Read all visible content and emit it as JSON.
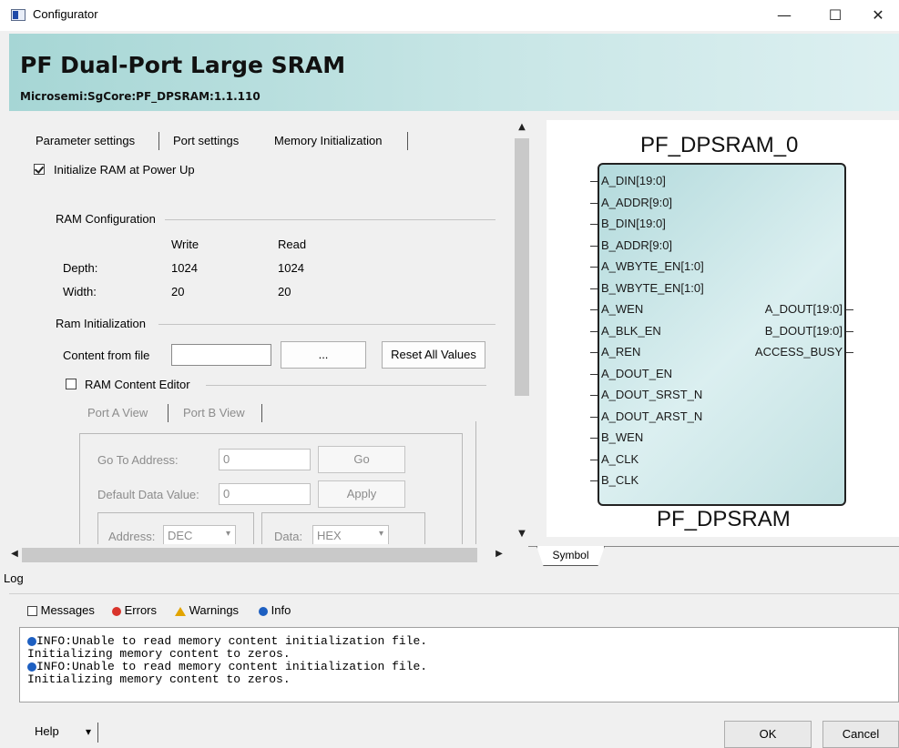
{
  "window": {
    "title": "Configurator",
    "minimize": "—",
    "maximize": "☐",
    "close": "✕"
  },
  "banner": {
    "title": "PF Dual-Port Large SRAM",
    "subtitle": "Microsemi:SgCore:PF_DPSRAM:1.1.110"
  },
  "tabs": [
    {
      "label": "Parameter settings"
    },
    {
      "label": "Port settings"
    },
    {
      "label": "Memory Initialization"
    }
  ],
  "init_ram": {
    "label": "Initialize RAM at Power Up",
    "checked": true
  },
  "ram_config": {
    "group_label": "RAM Configuration",
    "col_write": "Write",
    "col_read": "Read",
    "rows": [
      {
        "label": "Depth:",
        "write": "1024",
        "read": "1024"
      },
      {
        "label": "Width:",
        "write": "20",
        "read": "20"
      }
    ]
  },
  "ram_init": {
    "group_label": "Ram Initialization",
    "content_label": "Content from file",
    "content_value": "",
    "browse_label": "...",
    "reset_label": "Reset All Values"
  },
  "editor": {
    "label": "RAM Content Editor",
    "checked": false,
    "tab_a": "Port A View",
    "tab_b": "Port B View",
    "goto_label": "Go To Address:",
    "goto_value": "0",
    "go_button": "Go",
    "default_label": "Default Data Value:",
    "default_value": "0",
    "apply_button": "Apply",
    "address_label": "Address:",
    "address_value": "DEC",
    "data_label": "Data:",
    "data_value": "HEX"
  },
  "symbol": {
    "instance": "PF_DPSRAM_0",
    "component": "PF_DPSRAM",
    "left_pins": [
      "A_DIN[19:0]",
      "A_ADDR[9:0]",
      "B_DIN[19:0]",
      "B_ADDR[9:0]",
      "A_WBYTE_EN[1:0]",
      "B_WBYTE_EN[1:0]",
      "A_WEN",
      "A_BLK_EN",
      "A_REN",
      "A_DOUT_EN",
      "A_DOUT_SRST_N",
      "A_DOUT_ARST_N",
      "B_WEN",
      "A_CLK",
      "B_CLK"
    ],
    "right_pins": [
      "A_DOUT[19:0]",
      "B_DOUT[19:0]",
      "ACCESS_BUSY"
    ],
    "tab_label": "Symbol"
  },
  "log": {
    "title": "Log",
    "tabs": {
      "messages": "Messages",
      "errors": "Errors",
      "warnings": "Warnings",
      "info": "Info"
    },
    "lines": [
      "INFO:Unable to read memory content initialization file.",
      "Initializing memory content to zeros.",
      "INFO:Unable to read memory content initialization file.",
      "Initializing memory content to zeros."
    ]
  },
  "footer": {
    "help": "Help",
    "help_arrow": "▾",
    "ok": "OK",
    "cancel": "Cancel"
  },
  "icons": {
    "scroll_up": "▲",
    "scroll_down": "▼",
    "scroll_left": "◀",
    "scroll_right": "▶",
    "combo_arrow": "▾"
  },
  "colors": {
    "banner_start": "#a6d6d5",
    "banner_end": "#ddf0f1",
    "symbol_fill": "#c2e1e2",
    "info_blue": "#1d5fc1",
    "error_red": "#d9342b",
    "warning_yellow": "#e2a400"
  }
}
